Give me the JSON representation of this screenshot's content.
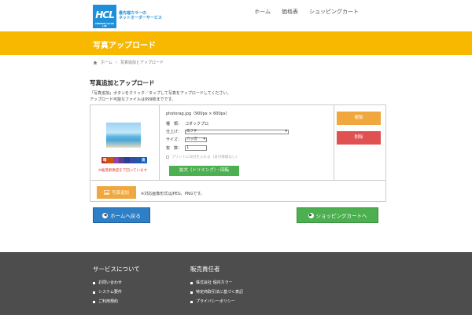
{
  "header": {
    "logo_text": "HCL",
    "logo_sub": "PREMIUM COLOR LAB",
    "tagline_line1": "最先端カラーの",
    "tagline_line2": "ネットオーダーサービス",
    "nav": [
      "ホーム",
      "価格表",
      "ショッピングカート"
    ]
  },
  "page": {
    "title": "写真アップロード",
    "breadcrumb": [
      "ホーム",
      "写真追加とアップロード"
    ],
    "section_title": "写真追加とアップロード",
    "desc_line1": "「写真追加」ボタンをクリック／タップして写真をアップロードしてください。",
    "desc_line2": "アップロード可能なファイルは999枚までです。"
  },
  "photo": {
    "palette_left": "暗",
    "palette_right": "良",
    "palette_colors": [
      "#c0392b",
      "#d35400",
      "#8e44ad",
      "#5b3f8f",
      "#2c3e91",
      "#3949ab",
      "#1e5aa8",
      "#1565c0"
    ],
    "warning": "※推奨解像度を下回っています",
    "filename": "photorag.jpg（900px × 600px）",
    "type_label": "種　類：",
    "type_value": "コダックプロ",
    "finish_label": "仕上げ：",
    "finish_value": "白フチ",
    "size_label": "サイズ：",
    "size_value": "六ッ切",
    "qty_label": "枚　数：",
    "qty_value": "1",
    "date_check": "プリントに日付を入れる",
    "date_note": "(日付情報なし)",
    "trim_button": "拡大（トリミング）・回転",
    "copy_button": "複製",
    "delete_button": "削除"
  },
  "actions": {
    "add_photo": "写真追加",
    "format_note": "※対応画像形式はJPEG、PNGです。",
    "back_home": "ホームへ戻る",
    "to_cart": "ショッピングカートへ"
  },
  "footer": {
    "col1_title": "サービスについて",
    "col1_items": [
      "お問い合わせ",
      "システム要件",
      "ご利用規約"
    ],
    "col2_title": "販売責任者",
    "col2_items": [
      "株式会社 堀内カラー",
      "特定商取引法に基づく表記",
      "プライバシーポリシー"
    ]
  }
}
